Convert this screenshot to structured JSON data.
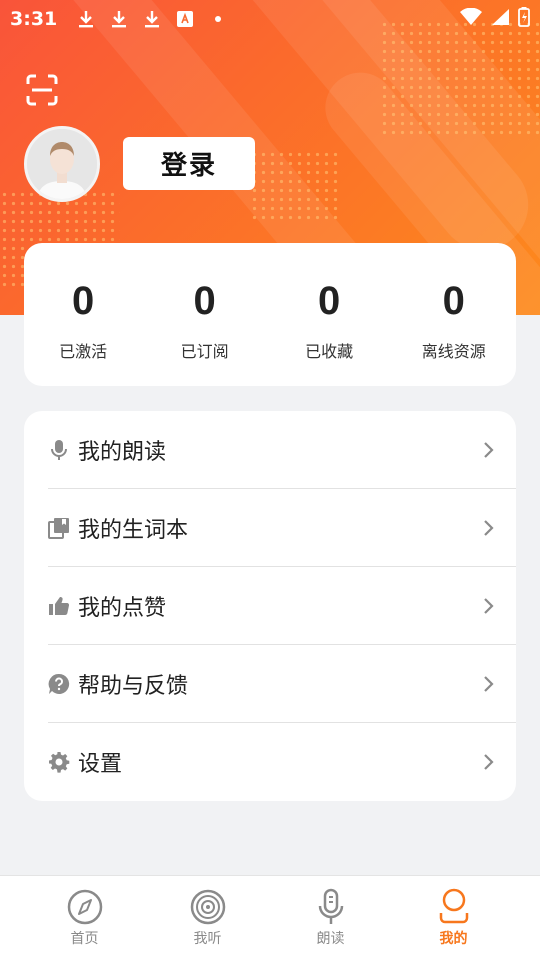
{
  "status_bar": {
    "time": "3:31"
  },
  "user": {
    "login_label": "登录"
  },
  "stats": [
    {
      "value": "0",
      "label": "已激活"
    },
    {
      "value": "0",
      "label": "已订阅"
    },
    {
      "value": "0",
      "label": "已收藏"
    },
    {
      "value": "0",
      "label": "离线资源"
    }
  ],
  "menu": [
    {
      "label": "我的朗读",
      "icon": "microphone-icon"
    },
    {
      "label": "我的生词本",
      "icon": "vocabulary-book-icon"
    },
    {
      "label": "我的点赞",
      "icon": "thumbs-up-icon"
    },
    {
      "label": "帮助与反馈",
      "icon": "help-question-icon"
    },
    {
      "label": "设置",
      "icon": "gear-icon"
    }
  ],
  "tabs": [
    {
      "label": "首页",
      "icon": "compass-icon"
    },
    {
      "label": "我听",
      "icon": "vinyl-disc-icon"
    },
    {
      "label": "朗读",
      "icon": "microphone-icon"
    },
    {
      "label": "我的",
      "icon": "person-icon",
      "active": true
    }
  ],
  "colors": {
    "accent": "#f7771d",
    "hero_start": "#f9543a",
    "hero_end": "#fd8a1c"
  }
}
